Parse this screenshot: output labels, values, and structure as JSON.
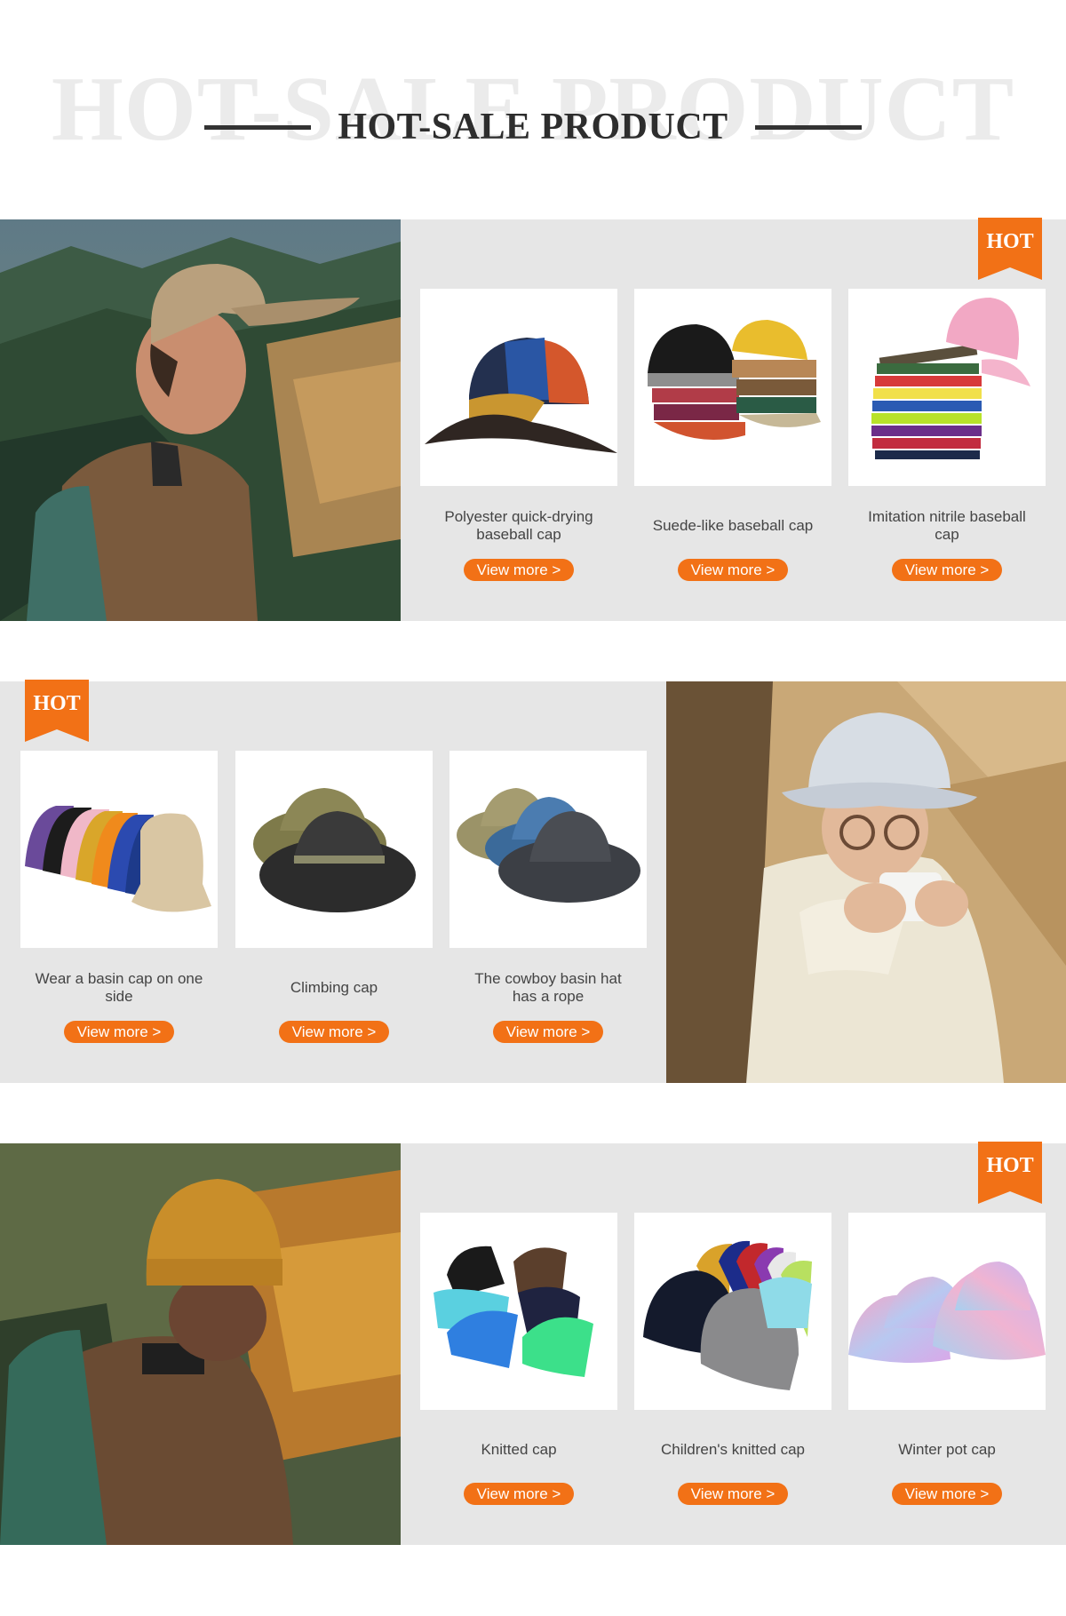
{
  "heading": {
    "background_text": "HOT-SALE PRODUCT",
    "title": "HOT-SALE PRODUCT"
  },
  "colors": {
    "accent": "#f27116",
    "panel": "#e6e6e6",
    "heading": "#2d2d2d"
  },
  "sections": [
    {
      "badge": "HOT",
      "photo": "man-in-khaki-baseball-cap",
      "products": [
        {
          "title": "Polyester quick-drying baseball cap",
          "button": "View more >",
          "icon": "panel-baseball-cap"
        },
        {
          "title": "Suede-like baseball cap",
          "button": "View more >",
          "icon": "suede-caps-stack"
        },
        {
          "title": "Imitation nitrile baseball cap",
          "button": "View more >",
          "icon": "colorful-caps-stack"
        }
      ]
    },
    {
      "badge": "HOT",
      "photo": "person-in-bucket-hat-drinking",
      "products": [
        {
          "title": "Wear a basin cap on one side",
          "button": "View more >",
          "icon": "bucket-hats-row"
        },
        {
          "title": "Climbing cap",
          "button": "View more >",
          "icon": "boonie-hats"
        },
        {
          "title": "The cowboy basin hat has a rope",
          "button": "View more >",
          "icon": "washed-boonie-hats"
        }
      ]
    },
    {
      "badge": "HOT",
      "photo": "man-in-mustard-beanie",
      "products": [
        {
          "title": "Knitted cap",
          "button": "View more >",
          "icon": "beanie-pile"
        },
        {
          "title": "Children's knitted cap",
          "button": "View more >",
          "icon": "beanie-stack"
        },
        {
          "title": "Winter pot cap",
          "button": "View more >",
          "icon": "tie-dye-bucket-hats"
        }
      ]
    }
  ]
}
